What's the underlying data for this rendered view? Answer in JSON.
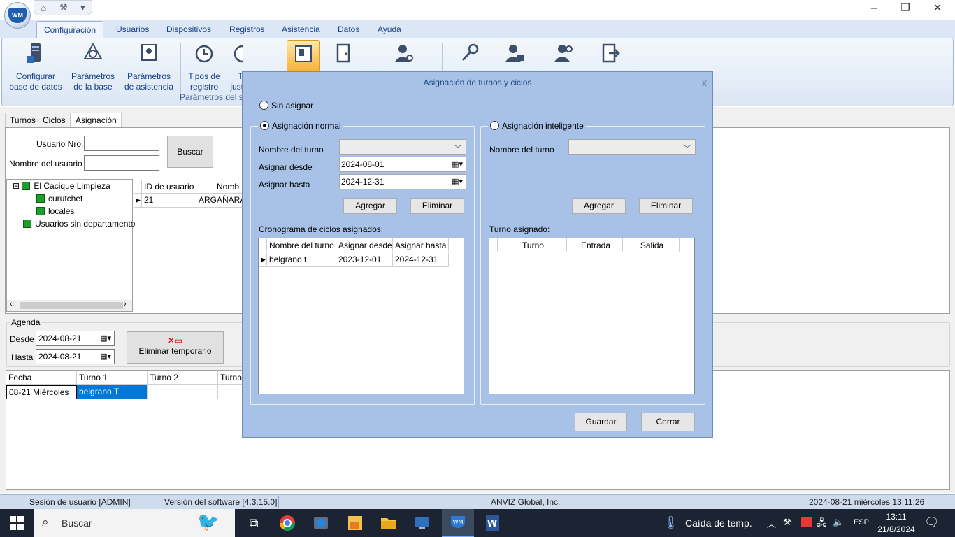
{
  "menu": {
    "tabs": [
      "Configuración",
      "Usuarios",
      "Dispositivos",
      "Registros",
      "Asistencia",
      "Datos",
      "Ayuda"
    ],
    "active_tab": "Configuración"
  },
  "ribbon": {
    "buttons": [
      {
        "line1": "Configurar",
        "line2": "base de datos"
      },
      {
        "line1": "Parámetros",
        "line2": "de la base"
      },
      {
        "line1": "Parámetros",
        "line2": "de asistencia"
      },
      {
        "line1": "Tipos de",
        "line2": "registro"
      },
      {
        "line1": "T",
        "line2": "just"
      }
    ],
    "group_label": "Parámetros del si"
  },
  "inner_tabs": [
    "Turnos",
    "Ciclos",
    "Asignación"
  ],
  "search": {
    "user_no_label": "Usuario Nro.",
    "user_name_label": "Nombre del usuario",
    "search_button": "Buscar"
  },
  "tree": {
    "root": "El Cacique Limpieza",
    "children": [
      "curutchet",
      "locales"
    ],
    "other": "Usuarios sin departamento"
  },
  "users_grid": {
    "headers": [
      "ID de usuario",
      "Nomb"
    ],
    "row": [
      "21",
      "ARGAÑARA"
    ]
  },
  "agenda": {
    "title": "Agenda",
    "desde_label": "Desde",
    "hasta_label": "Hasta",
    "desde_value": "2024-08-21",
    "hasta_value": "2024-08-21",
    "delete_temp_button": "Eliminar temporario",
    "headers": [
      "Fecha",
      "Turno 1",
      "Turno 2",
      "Turno"
    ],
    "row": [
      "08-21 Miércoles",
      "belgrano T",
      ""
    ]
  },
  "dialog": {
    "title": "Asignación de turnos y ciclos",
    "close": "x",
    "radio_sin_asignar": "Sin asignar",
    "radio_normal": "Asignación normal",
    "radio_inteligente": "Asignación inteligente",
    "nombre_turno_label": "Nombre del turno",
    "asignar_desde_label": "Asignar desde",
    "asignar_hasta_label": "Asignar hasta",
    "asignar_desde_value": "2024-08-01",
    "asignar_hasta_value": "2024-12-31",
    "agregar": "Agregar",
    "eliminar": "Eliminar",
    "cronograma_label": "Cronograma de ciclos asignados:",
    "cron_headers": [
      "Nombre del turno",
      "Asignar desde",
      "Asignar hasta"
    ],
    "cron_row": [
      "belgrano t",
      "2023-12-01",
      "2024-12-31"
    ],
    "turno_asignado_label": "Turno asignado:",
    "turno_headers": [
      "Turno",
      "Entrada",
      "Salida"
    ],
    "guardar": "Guardar",
    "cerrar": "Cerrar"
  },
  "status": {
    "session": "Sesión de usuario  [ADMIN]",
    "version": "Versión del software  [4.3.15.0]",
    "company": "ANVIZ Global, Inc.",
    "datetime": "2024-08-21 miércoles 13:11:26"
  },
  "taskbar": {
    "search_placeholder": "Buscar",
    "weather": "Caída de temp.",
    "lang": "ESP",
    "time": "13:11",
    "date": "21/8/2024"
  },
  "colors": {
    "ribbon_text": "#15428b",
    "dialog_bg": "#a7c2e6",
    "selection": "#0078d7",
    "taskbar": "#1c2433"
  }
}
